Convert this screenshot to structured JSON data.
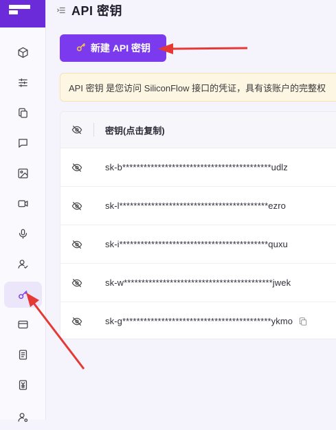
{
  "header": {
    "title": "API 密钥"
  },
  "toolbar": {
    "new_key_label": "新建 API 密钥",
    "new_key_icon": "key-icon"
  },
  "notice": {
    "text": "API 密钥 是您访问 SiliconFlow 接口的凭证，具有该账户的完整权"
  },
  "table": {
    "column_header": "密钥(点击复制)",
    "rows": [
      {
        "key": "sk-b******************************************udlz"
      },
      {
        "key": "sk-l******************************************ezro"
      },
      {
        "key": "sk-i******************************************quxu"
      },
      {
        "key": "sk-w******************************************jwek"
      },
      {
        "key": "sk-g******************************************ykmo"
      }
    ]
  },
  "sidebar": {
    "items": [
      {
        "icon": "cube-icon"
      },
      {
        "icon": "sliders-icon"
      },
      {
        "icon": "copy-icon"
      },
      {
        "icon": "chat-icon"
      },
      {
        "icon": "image-icon"
      },
      {
        "icon": "video-icon"
      },
      {
        "icon": "microphone-icon"
      },
      {
        "icon": "user-check-icon"
      },
      {
        "icon": "key-icon",
        "active": true
      },
      {
        "icon": "credit-card-icon"
      },
      {
        "icon": "document-icon"
      },
      {
        "icon": "yuan-icon"
      },
      {
        "icon": "user-settings-icon"
      }
    ]
  },
  "colors": {
    "brand": "#6c2bd9",
    "button": "#7b3aed",
    "annotation_arrow": "#e53935",
    "notice_bg": "#fdf6e3"
  }
}
